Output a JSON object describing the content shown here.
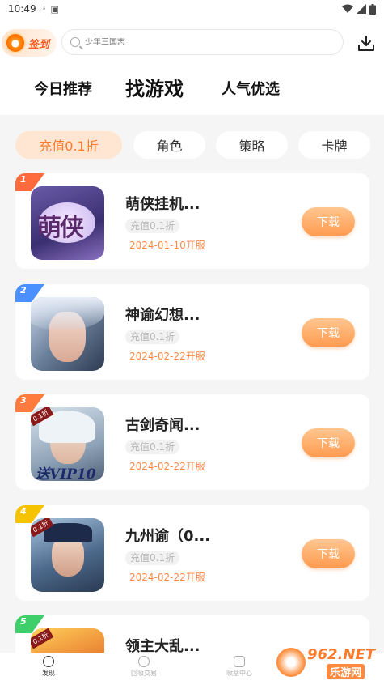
{
  "status_bar": {
    "time": "10:49"
  },
  "header": {
    "signin_label": "签到",
    "search_placeholder": "少年三国志",
    "tabs": [
      {
        "label": "今日推荐"
      },
      {
        "label": "找游戏",
        "active": true
      },
      {
        "label": "人气优选"
      }
    ]
  },
  "categories": [
    {
      "label": "充值0.1折",
      "active": true
    },
    {
      "label": "角色"
    },
    {
      "label": "策略"
    },
    {
      "label": "卡牌"
    }
  ],
  "games": [
    {
      "rank": "1",
      "name": "萌侠挂机...",
      "discount": "充值0.1折",
      "open_date": "2024-01-10开服",
      "button": "下载",
      "icon_text": "萌侠",
      "rank_color": "#ff6a3d"
    },
    {
      "rank": "2",
      "name": "神谕幻想...",
      "discount": "充值0.1折",
      "open_date": "2024-02-22开服",
      "button": "下载",
      "icon_text": "",
      "rank_color": "#4a90ff"
    },
    {
      "rank": "3",
      "name": "古剑奇闻...",
      "discount": "充值0.1折",
      "open_date": "2024-02-22开服",
      "button": "下载",
      "icon_text": "送VIP10",
      "icon_badge": "0.1折",
      "rank_color": "#ff7a3d"
    },
    {
      "rank": "4",
      "name": "九州谕（0...",
      "discount": "充值0.1折",
      "open_date": "2024-02-22开服",
      "button": "下载",
      "icon_text": "",
      "icon_badge": "0.1折",
      "rank_color": "#f5c300"
    },
    {
      "rank": "5",
      "name": "领主大乱...",
      "discount": "",
      "open_date": "",
      "button": "",
      "icon_text": "",
      "icon_badge": "0.1折",
      "rank_color": "#3ecf6a"
    }
  ],
  "bottom_nav": [
    {
      "label": "发现",
      "active": true
    },
    {
      "label": "回收交易"
    },
    {
      "label": "收益中心"
    }
  ],
  "watermark": {
    "text": "962.NET",
    "sub": "乐游网"
  },
  "colors": {
    "accent": "#ff9a4f",
    "background": "#f5f5f5"
  }
}
